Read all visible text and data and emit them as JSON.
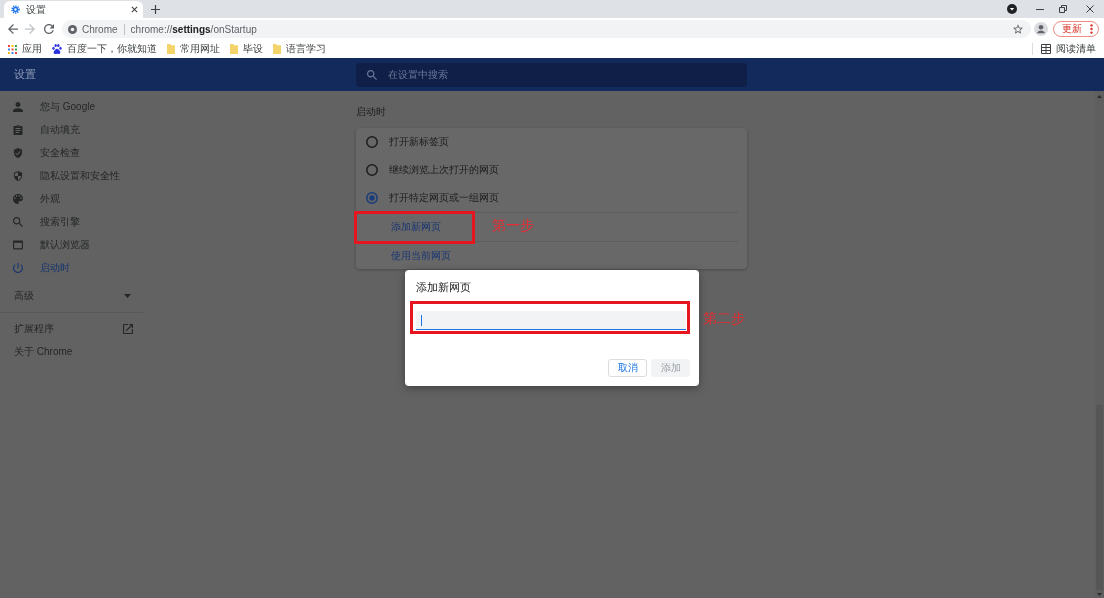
{
  "browser": {
    "tabs": [
      {
        "title": "设置",
        "selected": true
      }
    ],
    "navigation": [
      {
        "kind": "back",
        "disabled": false
      },
      {
        "kind": "forward",
        "disabled": true
      },
      {
        "kind": "reload",
        "disabled": false
      }
    ],
    "address_bar": {
      "site_label": "Chrome",
      "url": "chrome://**settings**/onStartup"
    },
    "update_button": "更新",
    "bookmarks": [
      {
        "kind": "apps",
        "label": "应用"
      },
      {
        "kind": "site",
        "label": "百度一下，你就知道"
      },
      {
        "kind": "folder",
        "label": "常用网址"
      },
      {
        "kind": "folder",
        "label": "毕设"
      },
      {
        "kind": "folder",
        "label": "语言学习"
      }
    ],
    "reading_list": "阅读清单"
  },
  "settings": {
    "title": "设置",
    "search": {
      "placeholder": "在设置中搜索"
    },
    "sidebar": {
      "items": [
        {
          "label": "您与 Google",
          "selected": false
        },
        {
          "label": "自动填充",
          "selected": false
        },
        {
          "label": "安全检查",
          "selected": false
        },
        {
          "label": "隐私设置和安全性",
          "selected": false
        },
        {
          "label": "外观",
          "selected": false
        },
        {
          "label": "搜索引擎",
          "selected": false
        },
        {
          "label": "默认浏览器",
          "selected": false
        },
        {
          "label": "启动时",
          "selected": true
        }
      ],
      "advanced": {
        "label": "高级",
        "expanded": false
      },
      "links": [
        {
          "label": "扩展程序",
          "external": true
        },
        {
          "label": "关于 Chrome",
          "external": false
        }
      ]
    },
    "section": {
      "title": "启动时",
      "options": [
        {
          "label": "打开新标签页",
          "selected": false
        },
        {
          "label": "继续浏览上次打开的网页",
          "selected": false
        },
        {
          "label": "打开特定网页或一组网页",
          "selected": true
        }
      ],
      "actions": [
        "添加新网页",
        "使用当前网页"
      ]
    }
  },
  "dialog": {
    "title": "添加新网页",
    "field": {
      "focused": true
    },
    "buttons": [
      {
        "label": "取消",
        "disabled": false
      },
      {
        "label": "添加",
        "disabled": true
      }
    ]
  },
  "annotations": [
    {
      "label": "第一步"
    },
    {
      "label": "第二步"
    }
  ]
}
